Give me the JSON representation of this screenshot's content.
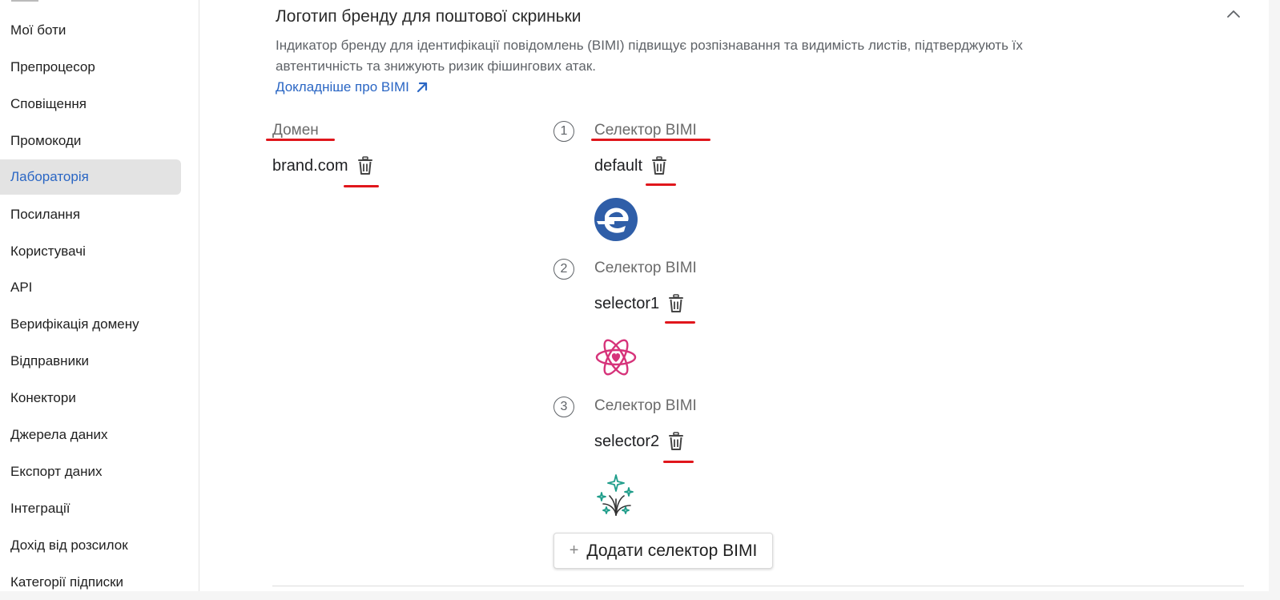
{
  "sidebar": {
    "items": [
      {
        "label": "Мої боти",
        "active": false
      },
      {
        "label": "Препроцесор",
        "active": false
      },
      {
        "label": "Сповіщення",
        "active": false
      },
      {
        "label": "Промокоди",
        "active": false
      },
      {
        "label": "Лабораторія",
        "active": true
      },
      {
        "label": "Посилання",
        "active": false
      },
      {
        "label": "Користувачі",
        "active": false
      },
      {
        "label": "API",
        "active": false
      },
      {
        "label": "Верифікація домену",
        "active": false
      },
      {
        "label": "Відправники",
        "active": false
      },
      {
        "label": "Конектори",
        "active": false
      },
      {
        "label": "Джерела даних",
        "active": false
      },
      {
        "label": "Експорт даних",
        "active": false
      },
      {
        "label": "Інтеграції",
        "active": false
      },
      {
        "label": "Дохід від розсилок",
        "active": false
      },
      {
        "label": "Категорії підписки",
        "active": false
      }
    ]
  },
  "section": {
    "title": "Логотип бренду для поштової скриньки",
    "description": "Індикатор бренду для ідентифікації повідомлень (BIMI) підвищує розпізнавання та видимість листів, підтверджують їх автентичність та знижують ризик фішингових атак.",
    "learn_more": "Докладніше про BIMI"
  },
  "domain": {
    "header": "Домен",
    "value": "brand.com"
  },
  "selectors": [
    {
      "number": "1",
      "header": "Селектор BIMI",
      "value": "default",
      "logo": "blue-e-logo-icon"
    },
    {
      "number": "2",
      "header": "Селектор BIMI",
      "value": "selector1",
      "logo": "pink-atom-heart-logo-icon"
    },
    {
      "number": "3",
      "header": "Селектор BIMI",
      "value": "selector2",
      "logo": "sparkles-fireworks-logo-icon"
    }
  ],
  "add_button": {
    "plus": "+",
    "label": "Додати селектор BIMI"
  },
  "colors": {
    "accent": "#2a66c4",
    "annotation_red": "#e0161c",
    "active_nav_bg": "#e3e3e3",
    "muted_text": "#5f6368"
  }
}
